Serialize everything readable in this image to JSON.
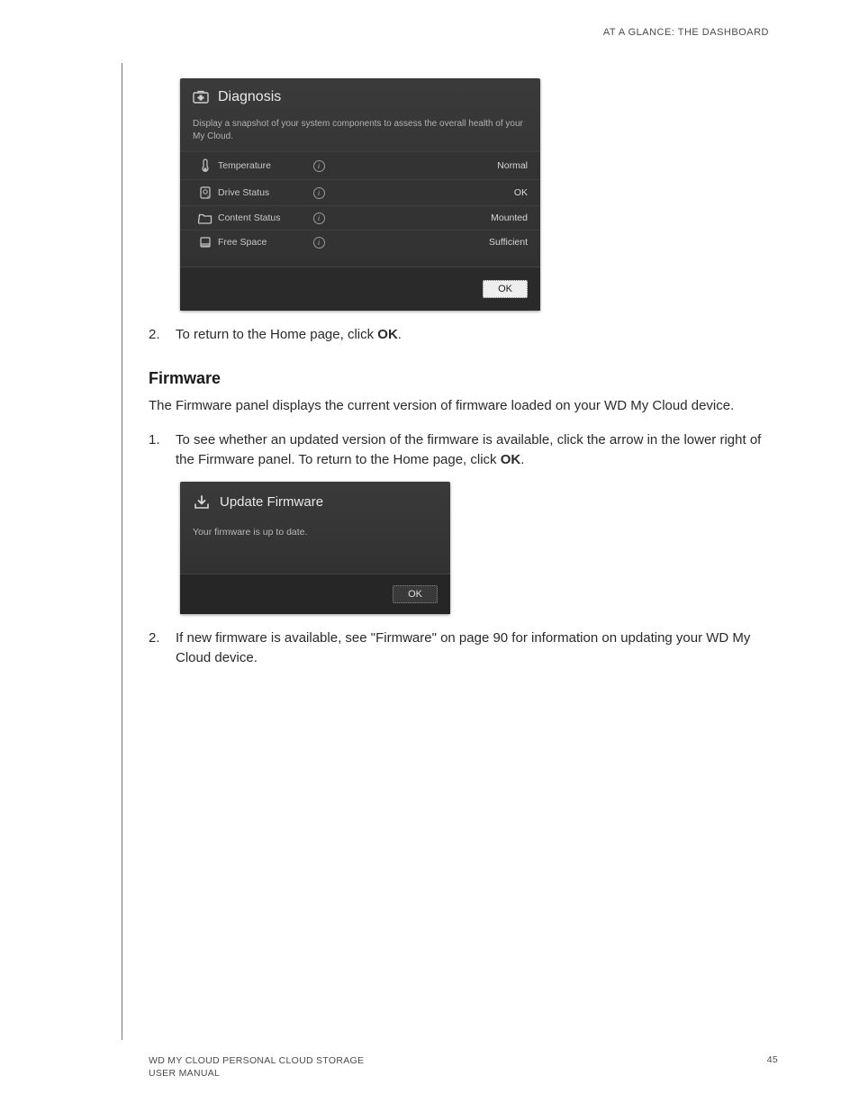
{
  "header": {
    "right": "AT A GLANCE: THE DASHBOARD"
  },
  "diagnosis": {
    "title": "Diagnosis",
    "description": "Display a snapshot of your system components to assess the overall health of your My Cloud.",
    "rows": [
      {
        "label": "Temperature",
        "value": "Normal"
      },
      {
        "label": "Drive Status",
        "value": "OK"
      },
      {
        "label": "Content Status",
        "value": "Mounted"
      },
      {
        "label": "Free Space",
        "value": "Sufficient"
      }
    ],
    "ok": "OK"
  },
  "steps1": {
    "n2": "2.",
    "t2a": "To return to the Home page, click ",
    "t2b": "OK",
    "t2c": "."
  },
  "firmware_section": {
    "heading": "Firmware",
    "intro": "The Firmware panel displays the current version of firmware loaded on your WD My Cloud device.",
    "n1": "1.",
    "t1a": "To see whether an updated version of the firmware is available, click the arrow in the lower right of the Firmware panel. To return to the Home page, click ",
    "t1b": "OK",
    "t1c": "."
  },
  "firmware_panel": {
    "title": "Update Firmware",
    "message": "Your firmware is up to date.",
    "ok": "OK"
  },
  "steps2": {
    "n2": "2.",
    "t2": "If new firmware is available, see \"Firmware\" on page 90 for information on updating your WD My Cloud device."
  },
  "footer": {
    "title1": "WD MY CLOUD PERSONAL CLOUD STORAGE",
    "title2": "USER MANUAL",
    "page": "45"
  }
}
